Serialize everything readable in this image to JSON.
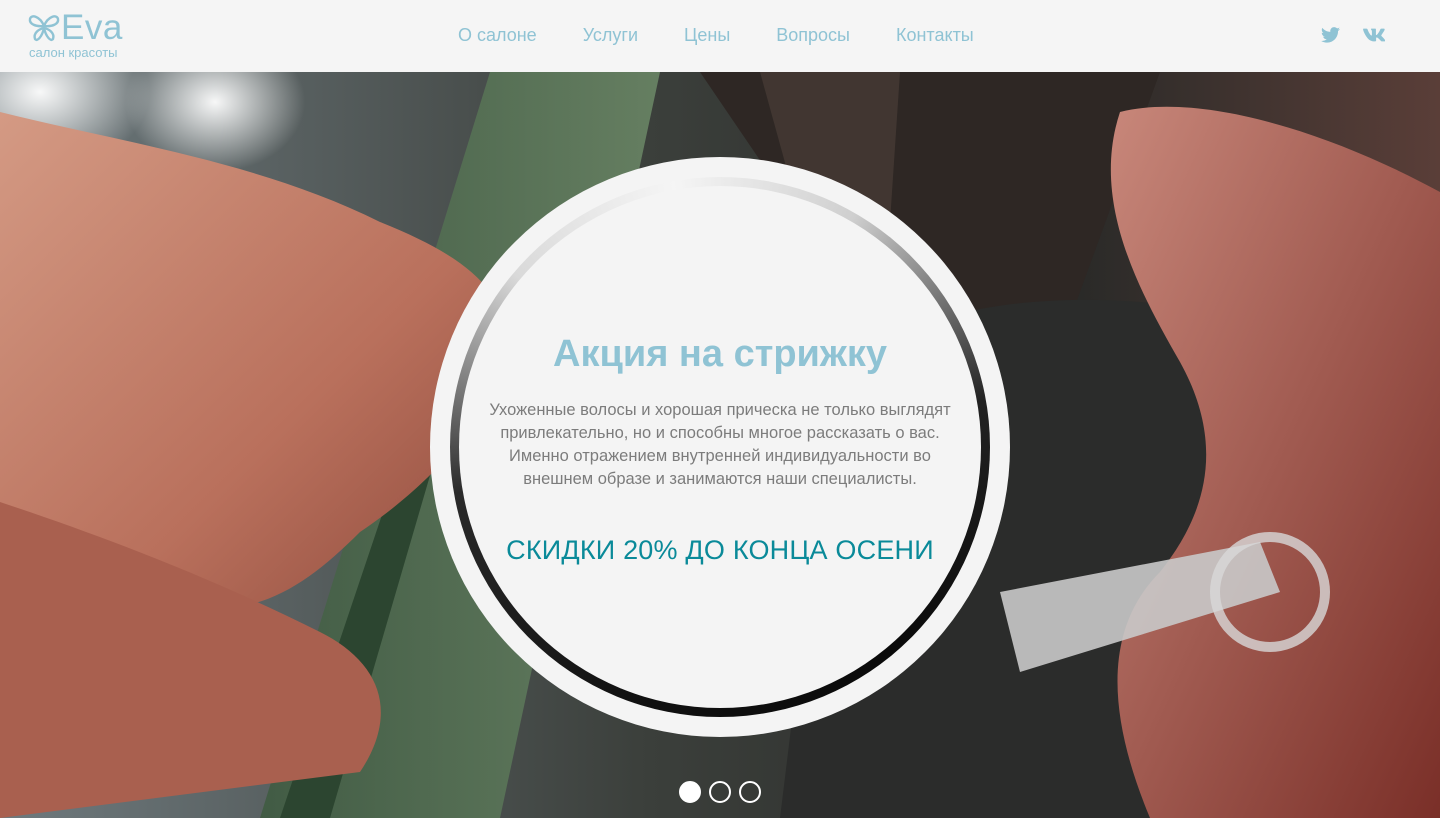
{
  "brand": {
    "name": "Eva",
    "tagline": "салон красоты",
    "color": "#8fc3d4"
  },
  "nav": {
    "items": [
      {
        "label": "О салоне"
      },
      {
        "label": "Услуги"
      },
      {
        "label": "Цены"
      },
      {
        "label": "Вопросы"
      },
      {
        "label": "Контакты"
      }
    ]
  },
  "social": {
    "items": [
      {
        "icon": "twitter-icon"
      },
      {
        "icon": "vk-icon"
      }
    ]
  },
  "promo": {
    "title": "Акция на стрижку",
    "text": "Ухоженные волосы и хорошая прическа не только выглядят привлекательно, но и способны многое рассказать о вас. Именно отражением внутренней индивидуальности во внешнем образе и занимаются наши специалисты.",
    "discount": "СКИДКИ 20% ДО КОНЦА ОСЕНИ",
    "title_color": "#8fc3d4",
    "discount_color": "#0a8a99"
  },
  "slider": {
    "slide_count": 3,
    "active_index": 0
  }
}
